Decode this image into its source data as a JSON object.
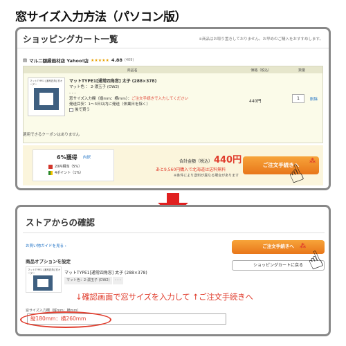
{
  "page_title": "窓サイズ入力方法（パソコン版）",
  "cart": {
    "title": "ショッピングカート一覧",
    "notice": "※商品はお取り置きしておりません。お早めのご購入をおすすめします。",
    "store_name": "マル二額縁画材店 Yahoo!店",
    "stars": "★★★★★",
    "rating": "4.88",
    "rating_count": "(409)",
    "columns": [
      "商品名",
      "価格（税込）",
      "数量"
    ],
    "item": {
      "thumb_label": "マットTYPE1 [通常四角] 窓オーダー",
      "name": "マットTYPE1[通常四角窓] 太子 (288×378)",
      "color": "マット色 ： 2-濃玉子 (OW2)",
      "dash": "- - -",
      "window_size_prefix": "窓サイズ入力欄（縦mm：横mm）：",
      "window_size_value": "ご注文手続きで入力してください",
      "shipping": "発送目安：1～3日以内に発送（休業日を除く）",
      "later": "後で買う",
      "price": "440円",
      "quantity": "1",
      "delete": "削除"
    },
    "coupon_text": "適用できるクーポンはありません",
    "earn_pct": "6%獲得",
    "earn_detail": "内訳",
    "earn_line1": "20円相当（5%）",
    "earn_line2": "4ポイント（1%）",
    "total_label": "合計金額（税込）",
    "total_value": "440円",
    "free_shipping": "あと9,560円購入で北海道は送料無料",
    "free_note": "※条件により送料が異なる場合があります",
    "checkout_label": "ご注文手続きへ"
  },
  "confirm": {
    "title": "ストアからの確認",
    "guide_link": "お買い物ガイドを見る ›",
    "options_label": "商品オプションを設定",
    "checkout_label": "ご注文手続きへ",
    "back_label": "ショッピングカートに戻る",
    "thumb_label": "マットTYPE1 [通常四角] 窓オーダー",
    "product_name": "マットTYPE1[通常四角窓]  太子 (288×378)",
    "product_color": "マット色：2-濃玉子 (OW2)",
    "product_dash": "- - -",
    "annotation": "↓確認画面で窓サイズを入力して ↑ご注文手続きへ",
    "input_label": "窓サイズ入力欄（縦mm：横mm）",
    "input_value": "縦180mm：横260mm"
  },
  "colors": {
    "accent_orange": "#e8761a",
    "alert_red": "#e03c2c",
    "arrow_red": "#e02020",
    "link_blue": "#1b6fc4"
  }
}
